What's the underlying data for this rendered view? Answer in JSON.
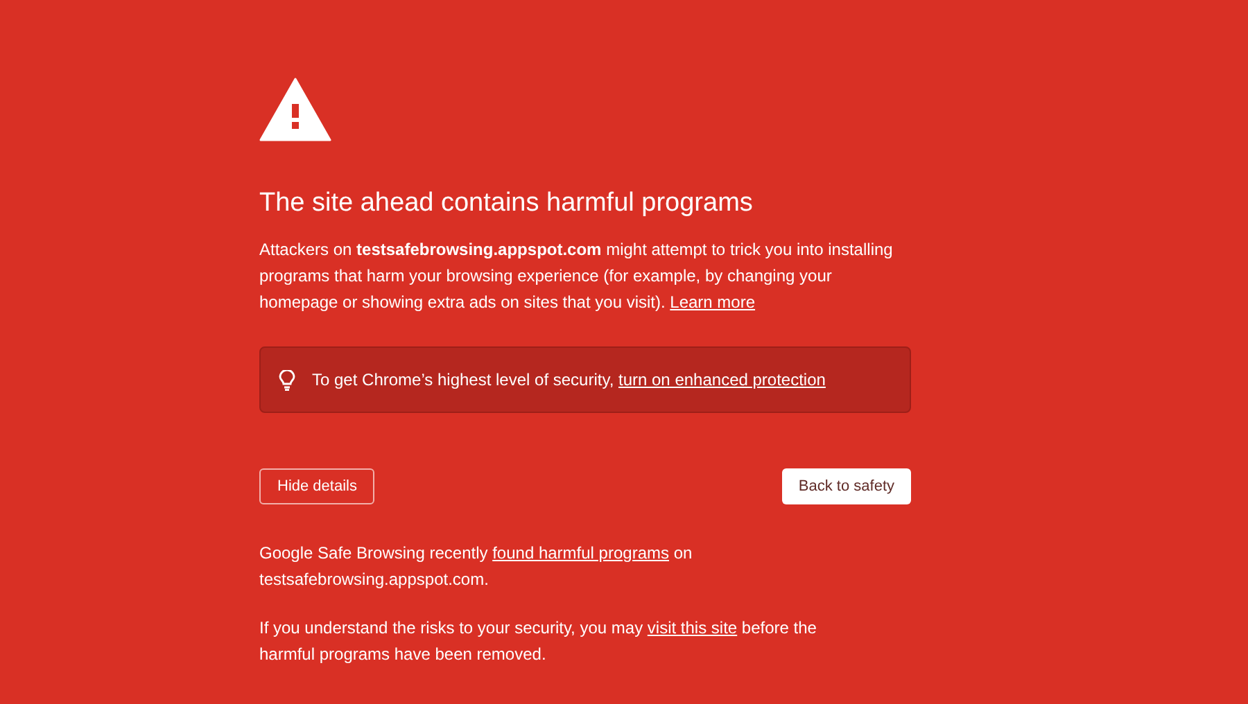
{
  "title": "The site ahead contains harmful programs",
  "intro": [
    {
      "kind": "text",
      "text": "Attackers on **testsafebrowsing.appspot.com** might attempt to trick you into installing programs that harm your browsing experience (for example, by changing your homepage or showing extra ads on sites that you visit). "
    },
    {
      "kind": "link",
      "text": "Learn more"
    }
  ],
  "banner": [
    {
      "kind": "text",
      "text": "To get Chrome’s highest level of security, "
    },
    {
      "kind": "link",
      "text": "turn on enhanced protection"
    }
  ],
  "buttons": [
    {
      "label": "Hide details",
      "kind": "outline"
    },
    {
      "label": "Back to safety",
      "kind": "primary"
    }
  ],
  "details": [
    [
      {
        "kind": "text",
        "text": "Google Safe Browsing recently "
      },
      {
        "kind": "link",
        "text": "found harmful programs"
      },
      {
        "kind": "text",
        "text": " on testsafebrowsing.appspot.com."
      }
    ],
    [
      {
        "kind": "text",
        "text": "If you understand the risks to your security, you may "
      },
      {
        "kind": "link",
        "text": "visit this site"
      },
      {
        "kind": "text",
        "text": " before the harmful programs have been removed."
      }
    ]
  ]
}
